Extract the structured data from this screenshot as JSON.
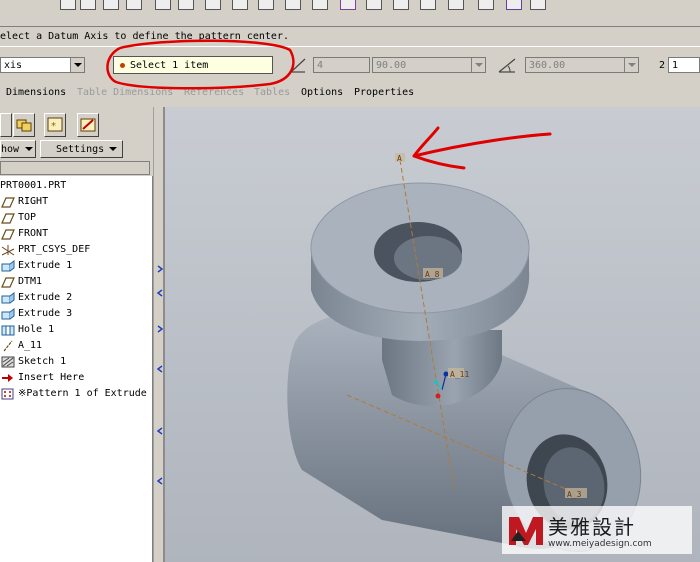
{
  "message": {
    "text": "elect a Datum Axis to define the pattern center."
  },
  "dashboard": {
    "pattern_type": {
      "value": "xis"
    },
    "reference_collector": {
      "text": "Select 1 item"
    },
    "first_count": {
      "value": "4"
    },
    "angle_increment": {
      "value": "90.00"
    },
    "extent_angle": {
      "value": "360.00"
    },
    "second_dir_count_label": "2",
    "second_dir_count": {
      "value": "1"
    }
  },
  "tabs": [
    {
      "label": "Dimensions",
      "enabled": true
    },
    {
      "label": "Table Dimensions",
      "enabled": false
    },
    {
      "label": "References",
      "enabled": false
    },
    {
      "label": "Tables",
      "enabled": false
    },
    {
      "label": "Options",
      "enabled": true
    },
    {
      "label": "Properties",
      "enabled": true
    }
  ],
  "model_tree": {
    "show_label": "how",
    "settings_label": "Settings",
    "items": [
      {
        "label": "PRT0001.PRT",
        "icon": "part-icon"
      },
      {
        "label": "RIGHT",
        "icon": "datum-plane-icon"
      },
      {
        "label": "TOP",
        "icon": "datum-plane-icon"
      },
      {
        "label": "FRONT",
        "icon": "datum-plane-icon"
      },
      {
        "label": "PRT_CSYS_DEF",
        "icon": "csys-icon"
      },
      {
        "label": "Extrude 1",
        "icon": "extrude-icon"
      },
      {
        "label": "DTM1",
        "icon": "datum-plane-icon"
      },
      {
        "label": "Extrude 2",
        "icon": "extrude-icon"
      },
      {
        "label": "Extrude 3",
        "icon": "extrude-icon"
      },
      {
        "label": "Hole 1",
        "icon": "hole-icon"
      },
      {
        "label": "A_11",
        "icon": "datum-axis-icon"
      },
      {
        "label": "Sketch 1",
        "icon": "sketch-icon"
      },
      {
        "label": "Insert Here",
        "icon": "insert-arrow-icon"
      },
      {
        "label": "※Pattern 1 of Extrude",
        "icon": "pattern-icon"
      }
    ]
  },
  "viewport": {
    "axis_labels": [
      "A",
      "A_8",
      "A_11",
      "A_3"
    ]
  },
  "watermark": {
    "chinese": "美雅設計",
    "url": "www.meiyadesign.com"
  },
  "colors": {
    "annotation_red": "#e00000",
    "axis_orange": "#b07a3a",
    "part_gray": "#8e99a6"
  }
}
